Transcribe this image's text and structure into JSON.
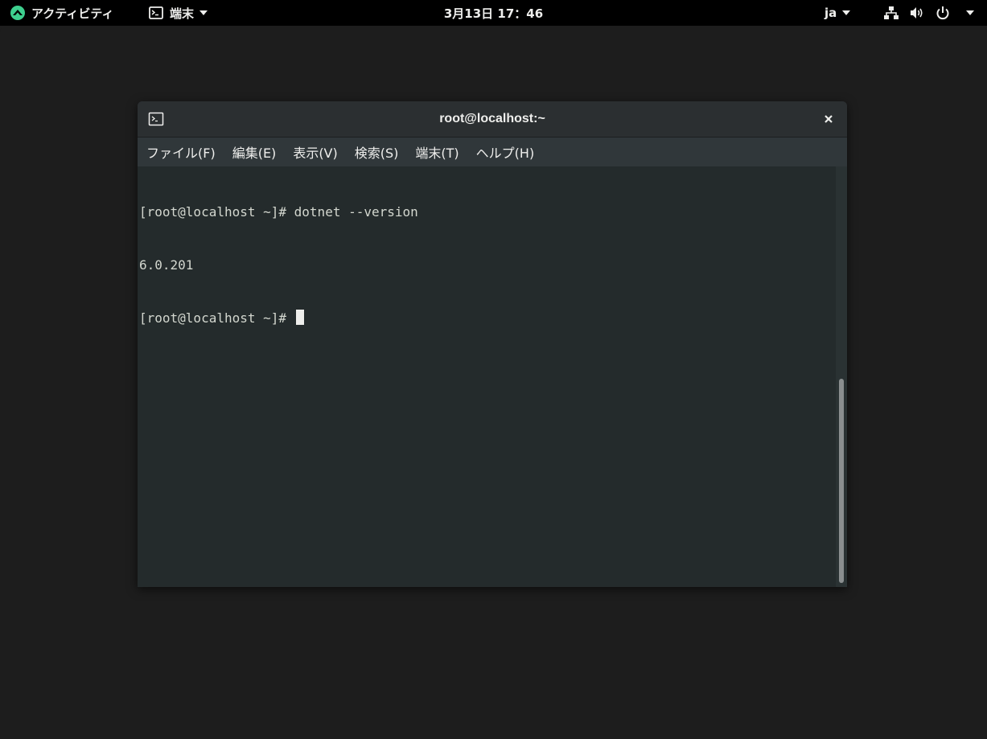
{
  "topbar": {
    "activities_label": "アクティビティ",
    "app_menu_label": "端末",
    "clock": "3月13日 17：46",
    "language": "ja",
    "icons": [
      "activities-logo-icon",
      "terminal-icon",
      "network-icon",
      "volume-icon",
      "power-icon"
    ]
  },
  "window": {
    "title": "root@localhost:~",
    "menu": [
      "ファイル(F)",
      "編集(E)",
      "表示(V)",
      "検索(S)",
      "端末(T)",
      "ヘルプ(H)"
    ],
    "terminal_lines": [
      "[root@localhost ~]# dotnet --version",
      "6.0.201",
      "[root@localhost ~]# "
    ]
  },
  "colors": {
    "topbar_bg": "#000000",
    "desktop_bg": "#1d1d1d",
    "terminal_bg": "#242b2c",
    "terminal_fg": "#d3d7cf",
    "logo_green": "#3ecf8e"
  }
}
